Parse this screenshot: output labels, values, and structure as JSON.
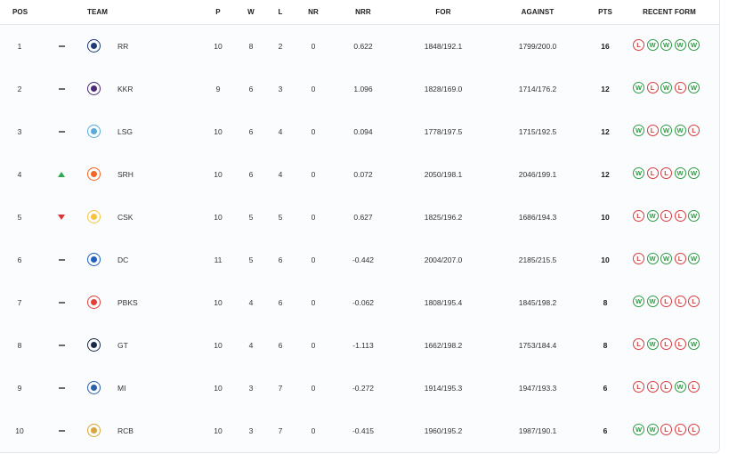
{
  "headers": {
    "pos": "POS",
    "team": "TEAM",
    "played": "P",
    "won": "W",
    "lost": "L",
    "no_result": "NR",
    "nrr": "NRR",
    "for": "FOR",
    "against": "AGAINST",
    "points": "PTS",
    "recent_form": "RECENT FORM"
  },
  "colors": {
    "win": "#2e9a44",
    "loss": "#d83b3b",
    "up": "#2fa84f",
    "down": "#d93333",
    "same": "#6b6b6b"
  },
  "rows": [
    {
      "pos": "1",
      "move": "same",
      "team": "RR",
      "logo": "rr-logo-icon",
      "logo_color": "#1f3b73",
      "p": "10",
      "w": "8",
      "l": "2",
      "nr": "0",
      "nrr": "0.622",
      "for": "1848/192.1",
      "against": "1799/200.0",
      "pts": "16",
      "form": [
        "L",
        "W",
        "W",
        "W",
        "W"
      ]
    },
    {
      "pos": "2",
      "move": "same",
      "team": "KKR",
      "logo": "kkr-logo-icon",
      "logo_color": "#4b2a73",
      "p": "9",
      "w": "6",
      "l": "3",
      "nr": "0",
      "nrr": "1.096",
      "for": "1828/169.0",
      "against": "1714/176.2",
      "pts": "12",
      "form": [
        "W",
        "L",
        "W",
        "L",
        "W"
      ]
    },
    {
      "pos": "3",
      "move": "same",
      "team": "LSG",
      "logo": "lsg-logo-icon",
      "logo_color": "#5aa9d6",
      "p": "10",
      "w": "6",
      "l": "4",
      "nr": "0",
      "nrr": "0.094",
      "for": "1778/197.5",
      "against": "1715/192.5",
      "pts": "12",
      "form": [
        "W",
        "L",
        "W",
        "W",
        "L"
      ]
    },
    {
      "pos": "4",
      "move": "up",
      "team": "SRH",
      "logo": "srh-logo-icon",
      "logo_color": "#f26522",
      "p": "10",
      "w": "6",
      "l": "4",
      "nr": "0",
      "nrr": "0.072",
      "for": "2050/198.1",
      "against": "2046/199.1",
      "pts": "12",
      "form": [
        "W",
        "L",
        "L",
        "W",
        "W"
      ]
    },
    {
      "pos": "5",
      "move": "down",
      "team": "CSK",
      "logo": "csk-logo-icon",
      "logo_color": "#f6c343",
      "p": "10",
      "w": "5",
      "l": "5",
      "nr": "0",
      "nrr": "0.627",
      "for": "1825/196.2",
      "against": "1686/194.3",
      "pts": "10",
      "form": [
        "L",
        "W",
        "L",
        "L",
        "W"
      ]
    },
    {
      "pos": "6",
      "move": "same",
      "team": "DC",
      "logo": "dc-logo-icon",
      "logo_color": "#1f5fbf",
      "p": "11",
      "w": "5",
      "l": "6",
      "nr": "0",
      "nrr": "-0.442",
      "for": "2004/207.0",
      "against": "2185/215.5",
      "pts": "10",
      "form": [
        "L",
        "W",
        "W",
        "L",
        "W"
      ]
    },
    {
      "pos": "7",
      "move": "same",
      "team": "PBKS",
      "logo": "pbks-logo-icon",
      "logo_color": "#e0403a",
      "p": "10",
      "w": "4",
      "l": "6",
      "nr": "0",
      "nrr": "-0.062",
      "for": "1808/195.4",
      "against": "1845/198.2",
      "pts": "8",
      "form": [
        "W",
        "W",
        "L",
        "L",
        "L"
      ]
    },
    {
      "pos": "8",
      "move": "same",
      "team": "GT",
      "logo": "gt-logo-icon",
      "logo_color": "#1b2a47",
      "p": "10",
      "w": "4",
      "l": "6",
      "nr": "0",
      "nrr": "-1.113",
      "for": "1662/198.2",
      "against": "1753/184.4",
      "pts": "8",
      "form": [
        "L",
        "W",
        "L",
        "L",
        "W"
      ]
    },
    {
      "pos": "9",
      "move": "same",
      "team": "MI",
      "logo": "mi-logo-icon",
      "logo_color": "#2b5fa8",
      "p": "10",
      "w": "3",
      "l": "7",
      "nr": "0",
      "nrr": "-0.272",
      "for": "1914/195.3",
      "against": "1947/193.3",
      "pts": "6",
      "form": [
        "L",
        "L",
        "L",
        "W",
        "L"
      ]
    },
    {
      "pos": "10",
      "move": "same",
      "team": "RCB",
      "logo": "rcb-logo-icon",
      "logo_color": "#d9a43b",
      "p": "10",
      "w": "3",
      "l": "7",
      "nr": "0",
      "nrr": "-0.415",
      "for": "1960/195.2",
      "against": "1987/190.1",
      "pts": "6",
      "form": [
        "W",
        "W",
        "L",
        "L",
        "L"
      ]
    }
  ]
}
